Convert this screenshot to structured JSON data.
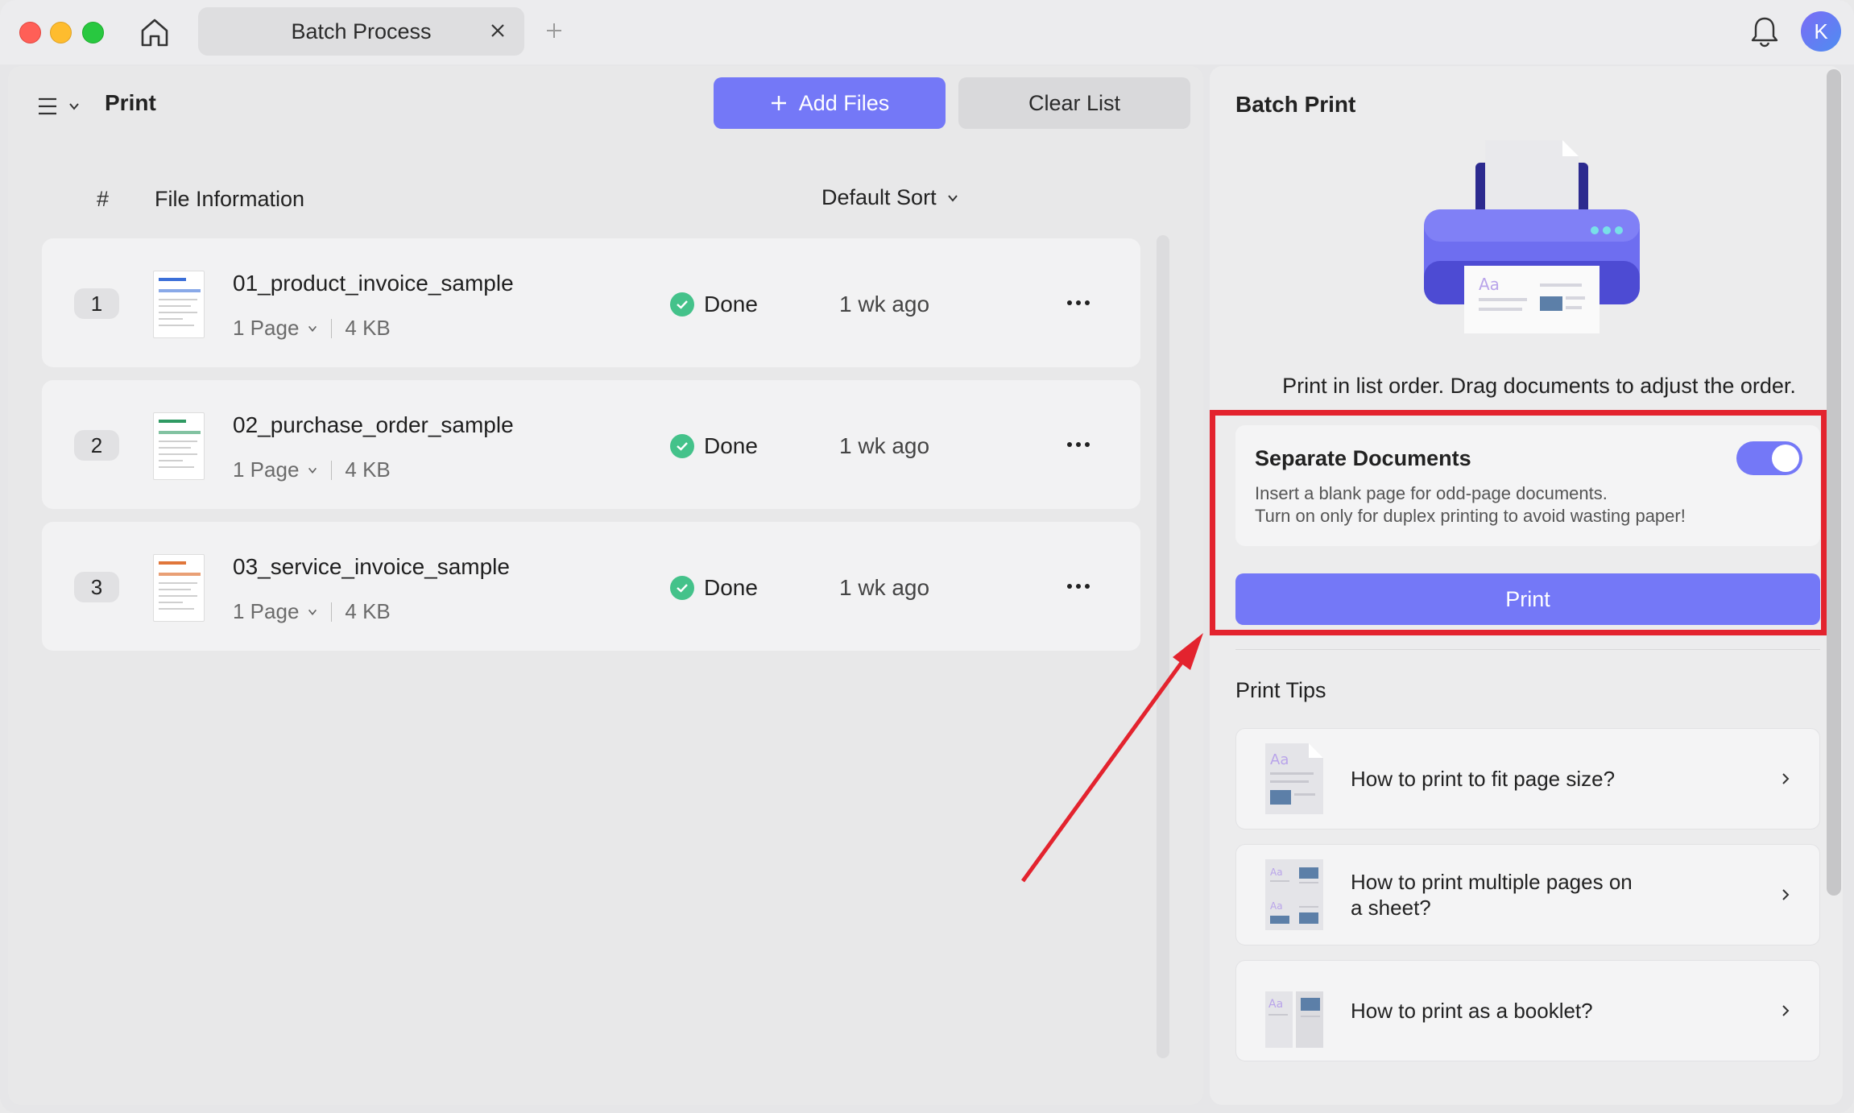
{
  "titlebar": {
    "tab_title": "Batch Process",
    "avatar_initial": "K"
  },
  "left_pane": {
    "title": "Print",
    "add_files_label": "Add Files",
    "clear_list_label": "Clear List",
    "columns": {
      "hash": "#",
      "info": "File Information",
      "sort": "Default Sort"
    },
    "files": [
      {
        "num": "1",
        "name": "01_product_invoice_sample",
        "pages": "1 Page",
        "size": "4 KB",
        "status": "Done",
        "time": "1 wk ago",
        "accent": "#3b6fd8"
      },
      {
        "num": "2",
        "name": "02_purchase_order_sample",
        "pages": "1 Page",
        "size": "4 KB",
        "status": "Done",
        "time": "1 wk ago",
        "accent": "#2f9a63"
      },
      {
        "num": "3",
        "name": "03_service_invoice_sample",
        "pages": "1 Page",
        "size": "4 KB",
        "status": "Done",
        "time": "1 wk ago",
        "accent": "#e0763a"
      }
    ]
  },
  "right_pane": {
    "title": "Batch Print",
    "description": "Print in list order. Drag documents to adjust the order.",
    "separate": {
      "title": "Separate Documents",
      "line1": "Insert a blank page for odd-page documents.",
      "line2": "Turn on only for duplex printing to avoid wasting paper!",
      "enabled": true
    },
    "print_label": "Print",
    "tips_title": "Print Tips",
    "tips": [
      {
        "line1": "How to print to fit page size?",
        "line2": ""
      },
      {
        "line1": "How to print multiple pages on",
        "line2": "a sheet?"
      },
      {
        "line1": "How to print as a booklet?",
        "line2": ""
      }
    ]
  },
  "colors": {
    "accent": "#7478f7",
    "done": "#44c28a",
    "annotation": "#e3232e"
  }
}
